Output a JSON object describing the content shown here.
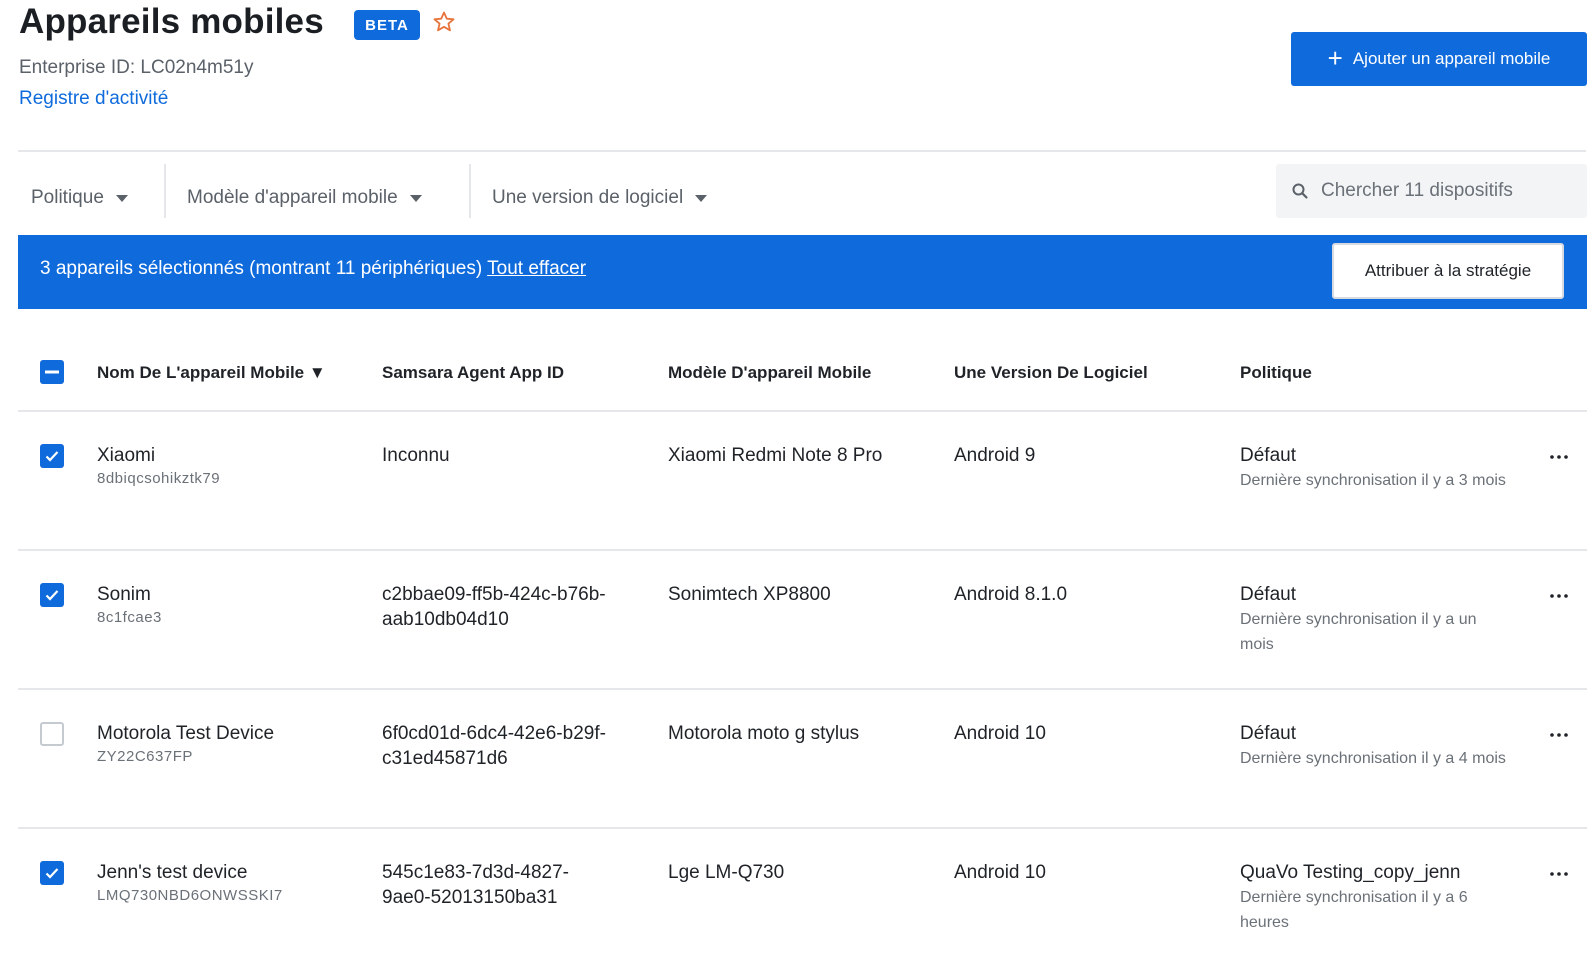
{
  "header": {
    "title": "Appareils mobiles",
    "badge": "BETA",
    "enterprise_id": "Enterprise ID: LC02n4m51y",
    "activity_link": "Registre d'activité",
    "add_button": "Ajouter un appareil mobile"
  },
  "filters": {
    "policy": "Politique",
    "model": "Modèle d'appareil mobile",
    "software": "Une version de logiciel",
    "search_placeholder": "Chercher 11 dispositifs"
  },
  "selection": {
    "text": "3 appareils sélectionnés (montrant 11 périphériques)",
    "clear_link": "Tout effacer",
    "assign_button": "Attribuer à la stratégie"
  },
  "table": {
    "columns": [
      "Nom De L'appareil Mobile ▼",
      "Samsara Agent App ID",
      "Modèle D'appareil Mobile",
      "Une Version De Logiciel",
      "Politique"
    ],
    "rows": [
      {
        "checked": true,
        "name": "Xiaomi",
        "serial": "8dbiqcsohikztk79",
        "app_id_1": "Inconnu",
        "app_id_2": "",
        "model": "Xiaomi Redmi Note 8 Pro",
        "version": "Android 9",
        "policy": "Défaut",
        "sync": "Dernière synchronisation il y a 3 mois"
      },
      {
        "checked": true,
        "name": "Sonim",
        "serial": "8c1fcae3",
        "app_id_1": "c2bbae09-ff5b-424c-b76b-",
        "app_id_2": "aab10db04d10",
        "model": "Sonimtech XP8800",
        "version": "Android 8.1.0",
        "policy": "Défaut",
        "sync": "Dernière synchronisation il y a un mois"
      },
      {
        "checked": false,
        "name": "Motorola Test Device",
        "serial": "ZY22C637FP",
        "app_id_1": "6f0cd01d-6dc4-42e6-b29f-",
        "app_id_2": "c31ed45871d6",
        "model": "Motorola moto g stylus",
        "version": "Android 10",
        "policy": "Défaut",
        "sync": "Dernière synchronisation il y a 4 mois"
      },
      {
        "checked": true,
        "name": "Jenn's test device",
        "serial": "LMQ730NBD6ONWSSKI7",
        "app_id_1": "545c1e83-7d3d-4827-",
        "app_id_2": "9ae0-52013150ba31",
        "model": "Lge LM-Q730",
        "version": "Android 10",
        "policy": "QuaVo Testing_copy_jenn",
        "sync": "Dernière synchronisation il y a 6 heures"
      }
    ]
  },
  "colors": {
    "accent": "#0f6bdc",
    "star": "#e8743b",
    "divider": "#e5e7ea"
  },
  "icons": [
    "star-icon",
    "plus-icon",
    "caret-down-icon",
    "search-icon",
    "checkbox-icon",
    "more-icon"
  ]
}
